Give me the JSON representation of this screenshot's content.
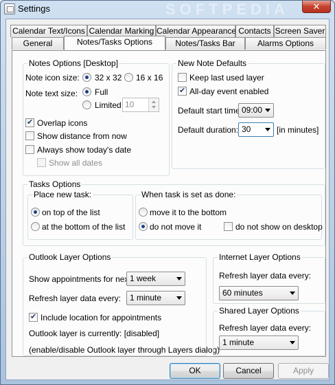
{
  "window": {
    "title": "Settings",
    "close_glyph": "✕",
    "watermark": "SOFTPEDIA"
  },
  "tabs_row1": [
    "Calendar Text/Icons",
    "Calendar Marking",
    "Calendar Appearance",
    "Contacts",
    "Screen Saver"
  ],
  "tabs_row2": [
    "General",
    "Notes/Tasks Options",
    "Notes/Tasks Bar",
    "Alarms Options"
  ],
  "active_tab": "Notes/Tasks Options",
  "notes_options": {
    "title": "Notes Options [Desktop]",
    "icon_size_label": "Note icon size:",
    "icon_size_options": [
      "32 x 32",
      "16 x 16"
    ],
    "icon_size_selected": "32 x 32",
    "text_size_label": "Note text size:",
    "text_full": "Full",
    "text_limited": "Limited",
    "text_selected": "Full",
    "limited_value": "10",
    "overlap_icons": "Overlap icons",
    "overlap_checked": true,
    "show_distance": "Show distance from now",
    "show_distance_checked": false,
    "always_today": "Always show today's date",
    "always_today_checked": false,
    "show_all_dates": "Show all dates",
    "show_all_dates_checked": false
  },
  "new_note_defaults": {
    "title": "New Note Defaults",
    "keep_last_layer": "Keep last used layer",
    "keep_last_layer_checked": false,
    "all_day": "All-day event enabled",
    "all_day_checked": true,
    "start_time_label": "Default start time:",
    "start_time_value": "09:00",
    "duration_label": "Default duration:",
    "duration_value": "30",
    "duration_unit": "[in minutes]"
  },
  "tasks_options": {
    "title": "Tasks Options",
    "place_label": "Place new task:",
    "place_top": "on top of the list",
    "place_bottom": "at the bottom of the list",
    "place_selected": "on top of the list",
    "done_label": "When task is set as done:",
    "done_move_bottom": "move it to the bottom",
    "done_no_move": "do not move it",
    "done_selected": "do not move it",
    "done_no_show": "do not show on desktop",
    "done_no_show_checked": false
  },
  "outlook_layer": {
    "title": "Outlook Layer Options",
    "show_appts_label": "Show appointments for next:",
    "show_appts_value": "1 week",
    "refresh_label": "Refresh layer data every:",
    "refresh_value": "1 minute",
    "include_location": "Include location for appointments",
    "include_location_checked": true,
    "status_text": "Outlook layer is currently: [disabled]",
    "hint_text": "(enable/disable Outlook layer through Layers dialog)"
  },
  "internet_layer": {
    "title": "Internet Layer Options",
    "refresh_label": "Refresh layer data every:",
    "refresh_value": "60 minutes"
  },
  "shared_layer": {
    "title": "Shared Layer Options",
    "refresh_label": "Refresh layer data every:",
    "refresh_value": "1 minute"
  },
  "buttons": {
    "ok": "OK",
    "cancel": "Cancel",
    "apply": "Apply"
  }
}
